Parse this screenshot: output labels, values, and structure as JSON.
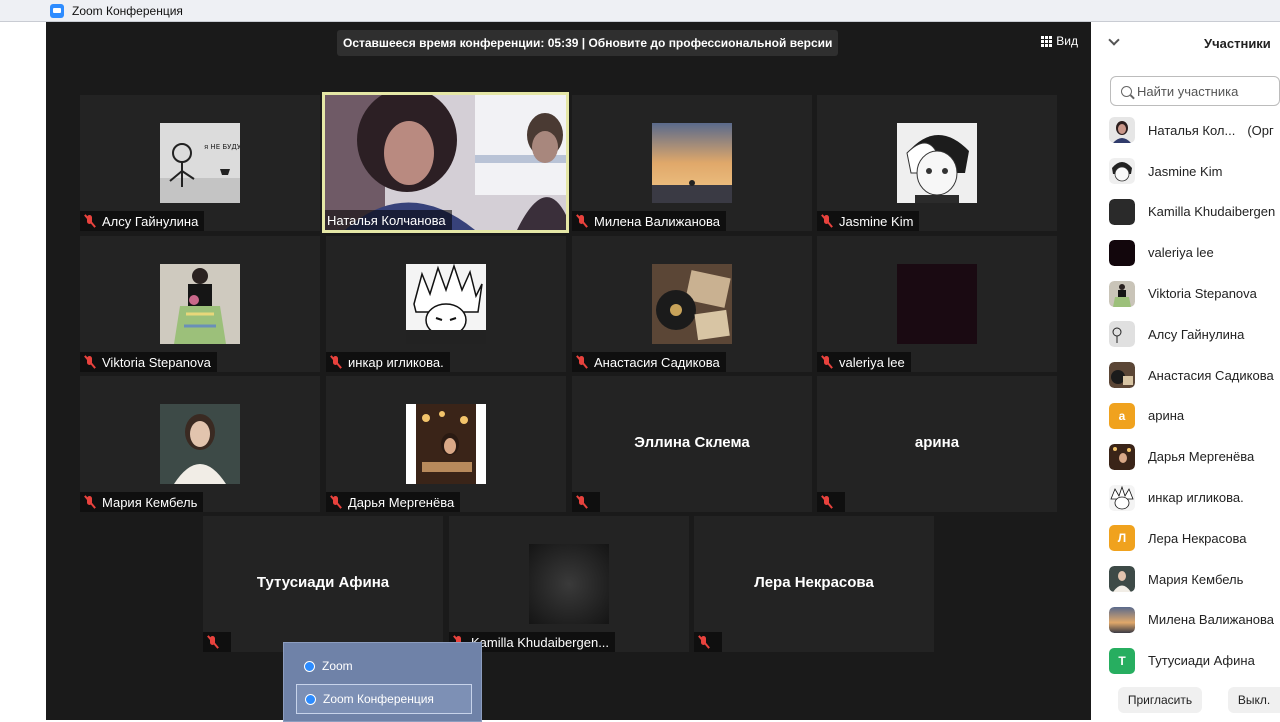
{
  "window": {
    "title": "Zoom Конференция"
  },
  "meeting": {
    "banner": "Оставшееся время конференции: 05:39 | Обновите до профессиональной версии",
    "view_label": "Вид"
  },
  "tiles": [
    {
      "name": "Алсу Гайнулина",
      "muted": true
    },
    {
      "name": "Наталья Колчанова",
      "active": true
    },
    {
      "name": "Милена Валижанова",
      "muted": true
    },
    {
      "name": "Jasmine Kim",
      "muted": true
    },
    {
      "name": "Viktoria Stepanova",
      "muted": true
    },
    {
      "name": "инкар игликова.",
      "muted": true
    },
    {
      "name": "Анастасия Садикова",
      "muted": true
    },
    {
      "name": "valeriya lee",
      "muted": true
    },
    {
      "name": "Мария Кембель",
      "muted": true
    },
    {
      "name": "Дарья Мергенёва",
      "muted": true
    },
    {
      "name": "Эллина Склема",
      "muted": true,
      "no_video": true
    },
    {
      "name": "арина",
      "muted": true,
      "no_video": true
    },
    {
      "name": "Тутусиади Афина",
      "muted": true,
      "no_video": true
    },
    {
      "name": "Kamilla Khudaibergen...",
      "muted": true
    },
    {
      "name": "Лера Некрасова",
      "muted": true,
      "no_video": true
    }
  ],
  "context_menu": {
    "items": [
      "Zoom",
      "Zoom Конференция"
    ]
  },
  "participants_panel": {
    "title": "Участники",
    "search_placeholder": "Найти участника",
    "participants": [
      {
        "name": "Наталья Кол...",
        "suffix": "(Орг",
        "avatar": "photo"
      },
      {
        "name": "Jasmine Kim",
        "avatar": "photo"
      },
      {
        "name": "Kamilla Khudaibergen",
        "avatar": "photo"
      },
      {
        "name": "valeriya lee",
        "avatar": "photo"
      },
      {
        "name": "Viktoria Stepanova",
        "avatar": "photo"
      },
      {
        "name": "Алсу Гайнулина",
        "avatar": "photo"
      },
      {
        "name": "Анастасия Садикова",
        "avatar": "photo"
      },
      {
        "name": "арина",
        "avatar": "а"
      },
      {
        "name": "Дарья Мергенёва",
        "avatar": "photo"
      },
      {
        "name": "инкар игликова.",
        "avatar": "photo"
      },
      {
        "name": "Лера Некрасова",
        "avatar": "Л"
      },
      {
        "name": "Мария Кембель",
        "avatar": "photo"
      },
      {
        "name": "Милена Валижанова",
        "avatar": "photo"
      },
      {
        "name": "Тутусиади Афина",
        "avatar": "Т"
      }
    ],
    "invite_label": "Пригласить",
    "mute_label": "Выкл."
  },
  "colors": {
    "meeting_bg": "#1a1a1a",
    "tile_bg": "#232323",
    "active_border": "#e5e7a6",
    "muted_icon": "#e8423d",
    "avatar_orange": "#f0a21e",
    "avatar_green": "#27ae60"
  }
}
